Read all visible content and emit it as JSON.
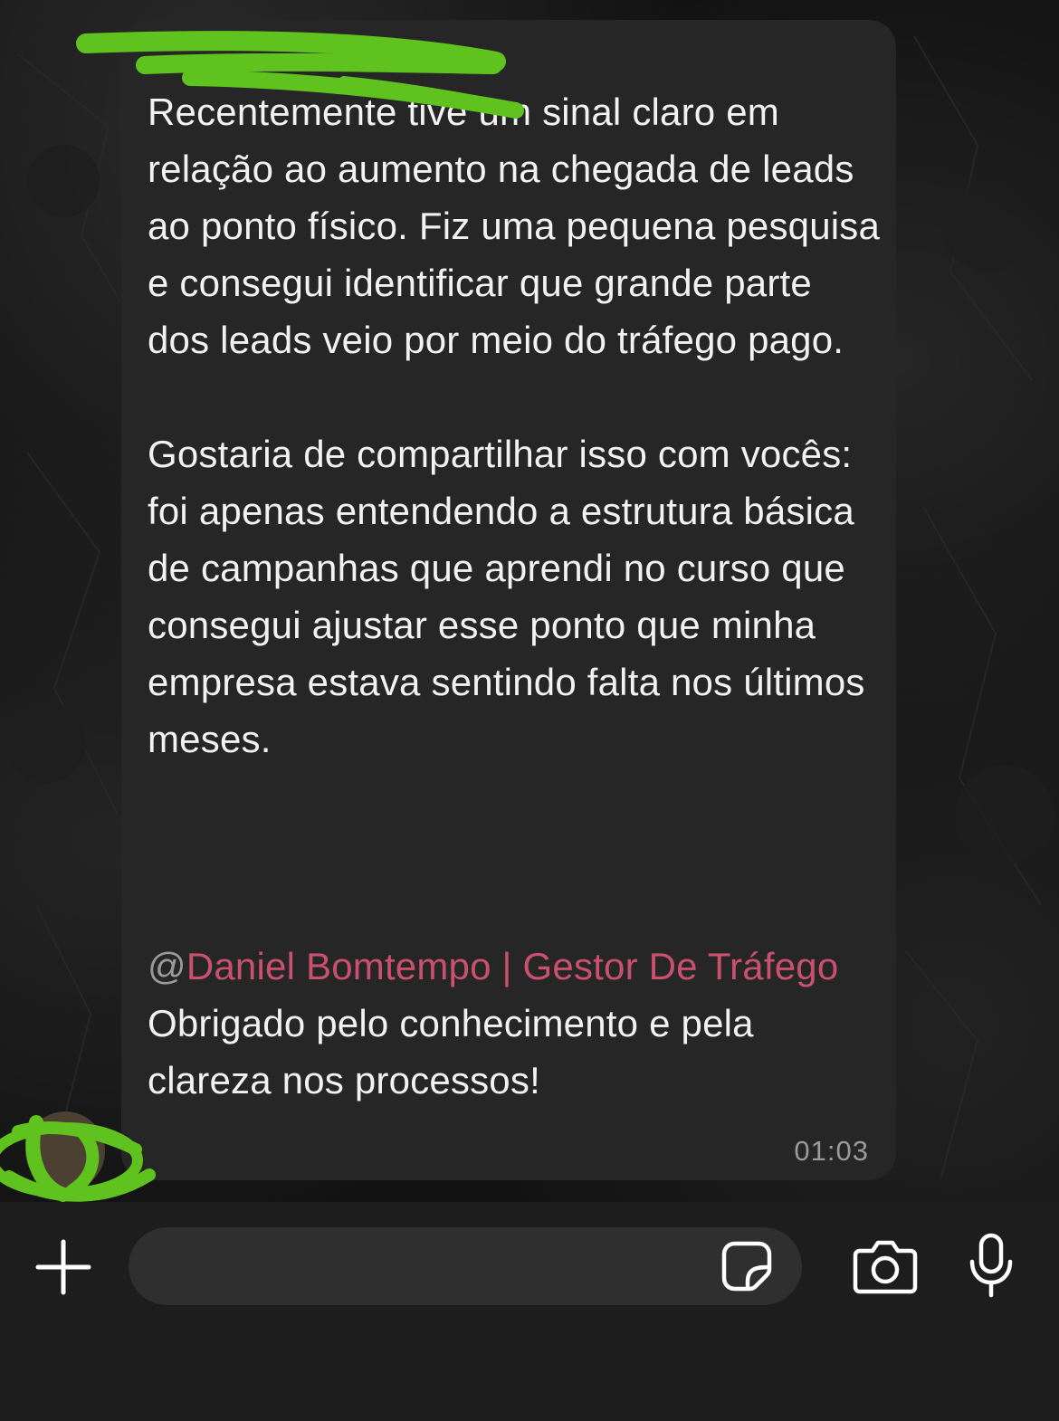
{
  "chat": {
    "message": {
      "text": "Recentemente tive um sinal claro em relação ao aumento na chegada de leads ao ponto físico. Fiz uma pequena pesquisa e consegui identificar que grande parte dos leads veio por meio do tráfego pago.\n\nGostaria de compartilhar isso com vocês: foi apenas entendendo a estrutura básica de campanhas que aprendi no curso que consegui ajustar esse ponto que minha empresa estava sentindo falta nos últimos meses.",
      "mention_prefix": "@",
      "mention_name": "Daniel Bomtempo | Gestor De Tráfego",
      "after_mention": " Obrigado pelo conhecimento e pela clareza nos processos!",
      "time": "01:03"
    }
  },
  "composer": {
    "placeholder": "",
    "value": ""
  },
  "icons": {
    "add": "plus-icon",
    "sticker": "sticker-icon",
    "camera": "camera-icon",
    "microphone": "microphone-icon"
  },
  "colors": {
    "mention": "#c9506e",
    "bubble": "#262626",
    "redaction": "#5fc21e"
  }
}
